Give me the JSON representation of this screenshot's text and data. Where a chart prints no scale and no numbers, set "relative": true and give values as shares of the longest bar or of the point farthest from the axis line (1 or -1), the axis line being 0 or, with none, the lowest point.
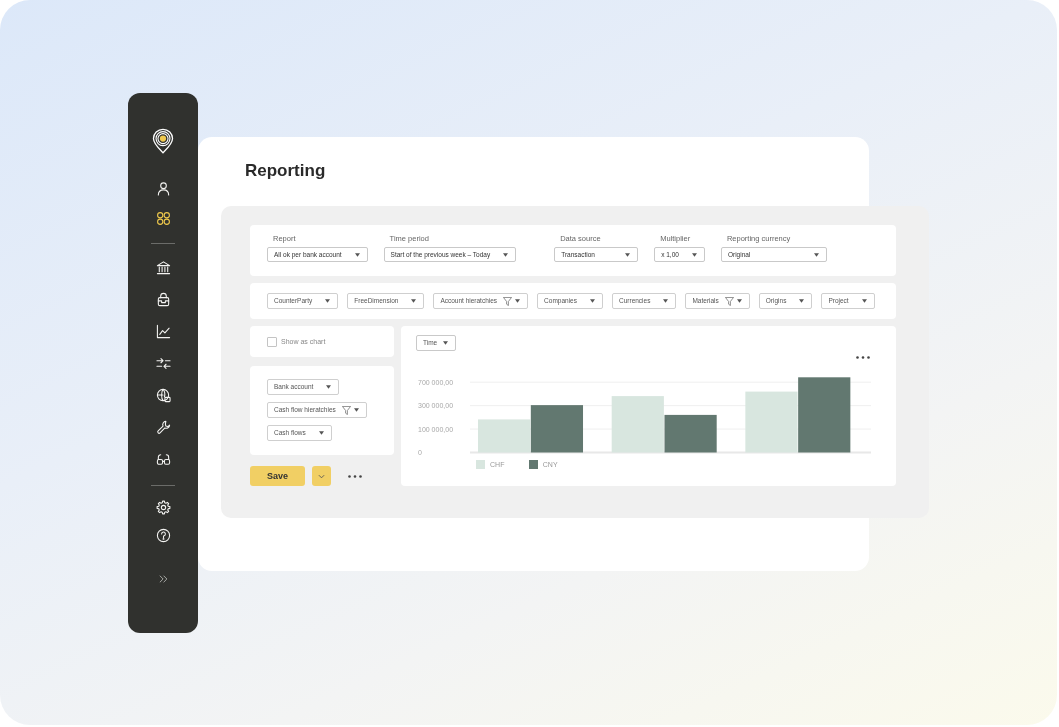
{
  "sidebar": {
    "sections": [
      {
        "items": [
          {
            "selected": false
          },
          {
            "selected": true
          }
        ]
      },
      {
        "items": [
          {
            "selected": false
          },
          {
            "selected": false
          },
          {
            "selected": false
          },
          {
            "selected": false
          },
          {
            "selected": false
          },
          {
            "selected": false
          },
          {
            "selected": false
          }
        ]
      },
      {
        "items": [
          {
            "selected": false
          },
          {
            "selected": false
          }
        ]
      }
    ]
  },
  "page": {
    "title": "Reporting"
  },
  "report_settings": [
    {
      "label": "Report",
      "value": "All ok per bank account"
    },
    {
      "label": "Time period",
      "value": "Start of the previous week – Today"
    },
    {
      "label": "Data source",
      "value": "Transaction"
    },
    {
      "label": "Multiplier",
      "value": "x 1,00"
    },
    {
      "label": "Reporting currency",
      "value": "Original"
    }
  ],
  "dimension_filters": [
    {
      "label": "CounterParty",
      "filtered": false
    },
    {
      "label": "FreeDimension",
      "filtered": false
    },
    {
      "label": "Account hieratchies",
      "filtered": true
    },
    {
      "label": "Companies",
      "filtered": false
    },
    {
      "label": "Currencies",
      "filtered": false
    },
    {
      "label": "Materials",
      "filtered": true
    },
    {
      "label": "Origins",
      "filtered": false
    },
    {
      "label": "Project",
      "filtered": false
    }
  ],
  "show_as_chart": {
    "label": "Show as chart",
    "checked": false
  },
  "row_dimensions": [
    {
      "label": "Bank account",
      "filtered": false
    },
    {
      "label": "Cash flow hieratchies",
      "filtered": true
    },
    {
      "label": "Cash flows",
      "filtered": false
    }
  ],
  "actions": {
    "save": "Save"
  },
  "chart_panel": {
    "dimension": "Time",
    "y_axis_labels": [
      "700 000,00",
      "300 000,00",
      "100 000,00",
      "0"
    ],
    "chart_data": {
      "type": "bar",
      "relative": true,
      "series": [
        {
          "name": "CHF",
          "color": "#d8e6df",
          "values": [
            0.44,
            0.75,
            0.81
          ]
        },
        {
          "name": "CNY",
          "color": "#627870",
          "values": [
            0.63,
            0.5,
            1.0
          ]
        }
      ]
    }
  }
}
